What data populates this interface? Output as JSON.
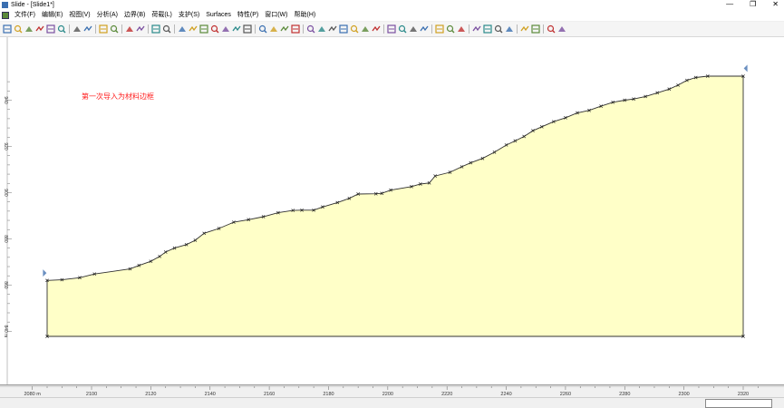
{
  "window": {
    "title": "Slide - [Slide1*]",
    "buttons": {
      "minimize": "—",
      "restore": "❐",
      "close": "✕"
    }
  },
  "menu": {
    "items": [
      "文件(F)",
      "编辑(E)",
      "视图(V)",
      "分析(A)",
      "边界(B)",
      "荷载(L)",
      "支护(S)",
      "Surfaces",
      "特性(P)",
      "窗口(W)",
      "帮助(H)"
    ]
  },
  "toolbar": {
    "icons": [
      "new-file-icon",
      "open-folder-icon",
      "save-icon",
      "print-preview-icon",
      "print-icon",
      "color-icon",
      "undo-icon",
      "redo-icon",
      "copy-icon",
      "paste-icon",
      "pan-icon",
      "info-icon",
      "screen-icon",
      "image-icon",
      "zoom-all-icon",
      "zoom-in-icon",
      "zoom-out-icon",
      "zoom-extents-icon",
      "zoom-window-icon",
      "zoom-previous-icon",
      "zoom-slope-icon",
      "material-icon",
      "boundary-icon",
      "external-boundary-icon",
      "material-boundary-icon",
      "add-vertex-icon",
      "delete-vertex-icon",
      "move-vertex-icon",
      "water-icon",
      "joint-icon",
      "reverse-icon",
      "delete-boundary-icon",
      "support-icon",
      "anchor-icon",
      "load-icon",
      "line-load-icon",
      "properties-icon",
      "assign-icon",
      "surface-icon",
      "circle-surface-icon",
      "noncircle-surface-icon",
      "grid-icon",
      "slope-limits-icon",
      "compute-icon",
      "interpret-icon",
      "results-icon",
      "report-icon"
    ]
  },
  "annotation": {
    "text": "第一次导入为材料边框",
    "color": "#ff2020"
  },
  "colors": {
    "material_fill": "#ffffc8",
    "boundary": "#303030",
    "vertex": "#202020",
    "marker": "#6a8fc0"
  },
  "axes": {
    "x_ticks": [
      "2080 m",
      "2100",
      "2120",
      "2140",
      "2160",
      "2180",
      "2200",
      "2220",
      "2240",
      "2260",
      "2280",
      "2300",
      "2320"
    ],
    "y_ticks": [
      "940",
      "920",
      "900",
      "880",
      "860",
      "840 m"
    ],
    "x_range": [
      2080,
      2330
    ],
    "y_range": [
      837,
      950
    ]
  },
  "chart_data": {
    "type": "area",
    "title": "",
    "xlabel": "",
    "ylabel": "",
    "x_unit": "m",
    "y_unit": "m",
    "external_boundary": {
      "surface": [
        [
          2085,
          862
        ],
        [
          2090,
          862.3
        ],
        [
          2096,
          863.2
        ],
        [
          2101,
          864.8
        ],
        [
          2113,
          867
        ],
        [
          2116,
          868.5
        ],
        [
          2120,
          870.3
        ],
        [
          2123,
          872.4
        ],
        [
          2125,
          874.3
        ],
        [
          2128,
          876
        ],
        [
          2132,
          877.5
        ],
        [
          2135,
          879.4
        ],
        [
          2138,
          882.4
        ],
        [
          2143,
          884.5
        ],
        [
          2148,
          887.2
        ],
        [
          2153,
          888.3
        ],
        [
          2158,
          889.6
        ],
        [
          2163,
          891.3
        ],
        [
          2168,
          892.3
        ],
        [
          2171,
          892.4
        ],
        [
          2175,
          892.4
        ],
        [
          2178,
          893.8
        ],
        [
          2183,
          895.7
        ],
        [
          2187,
          897.5
        ],
        [
          2190,
          899.4
        ],
        [
          2196,
          899.5
        ],
        [
          2198,
          899.7
        ],
        [
          2201,
          901.1
        ],
        [
          2208,
          902.6
        ],
        [
          2211,
          903.7
        ],
        [
          2214,
          904.2
        ],
        [
          2216,
          907.2
        ],
        [
          2221,
          908.8
        ],
        [
          2225,
          911.2
        ],
        [
          2228,
          912.9
        ],
        [
          2232,
          914.8
        ],
        [
          2236,
          917.5
        ],
        [
          2240,
          920.6
        ],
        [
          2243,
          922.4
        ],
        [
          2246,
          924.3
        ],
        [
          2249,
          926.8
        ],
        [
          2252,
          928.5
        ],
        [
          2256,
          930.7
        ],
        [
          2260,
          932.4
        ],
        [
          2264,
          934.5
        ],
        [
          2268,
          935.6
        ],
        [
          2272,
          937.4
        ],
        [
          2276,
          939.1
        ],
        [
          2280,
          940
        ],
        [
          2283,
          940.5
        ],
        [
          2287,
          941.6
        ],
        [
          2291,
          943.2
        ],
        [
          2295,
          944.8
        ],
        [
          2298,
          946.5
        ],
        [
          2301,
          948.6
        ],
        [
          2304,
          949.8
        ],
        [
          2308,
          950.4
        ],
        [
          2320,
          950.4
        ]
      ],
      "bottom": [
        [
          2320,
          837.8
        ],
        [
          2085,
          837.8
        ]
      ]
    },
    "markers": [
      {
        "x": 2084.5,
        "y": 865.2,
        "side": "left"
      },
      {
        "x": 2320.5,
        "y": 953.8,
        "side": "right"
      }
    ]
  }
}
